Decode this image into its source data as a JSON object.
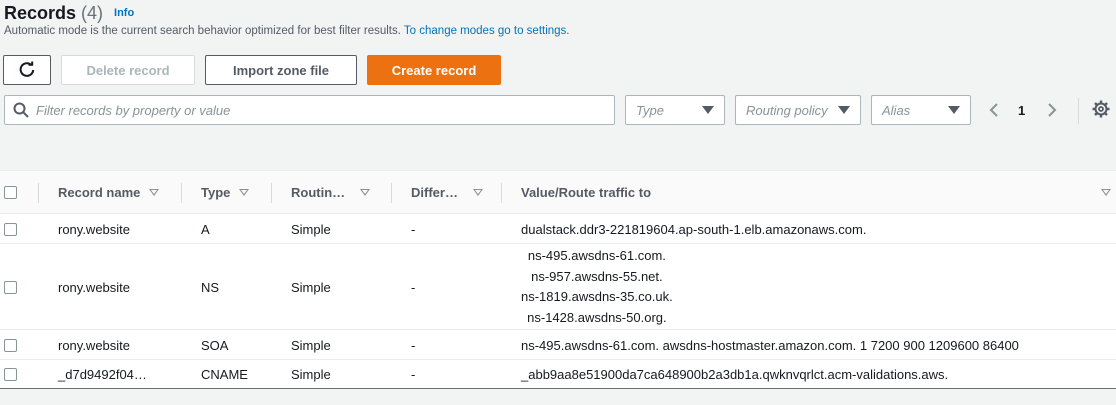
{
  "header": {
    "title": "Records",
    "count": "(4)",
    "info": "Info"
  },
  "description": {
    "text": "Automatic mode is the current search behavior optimized for best filter results. ",
    "link": "To change modes go to settings."
  },
  "toolbar": {
    "delete": "Delete record",
    "import": "Import zone file",
    "create": "Create record"
  },
  "filters": {
    "search_placeholder": "Filter records by property or value",
    "type": "Type",
    "routing": "Routing policy",
    "alias": "Alias"
  },
  "pagination": {
    "page": "1"
  },
  "columns": {
    "record_name": "Record name",
    "type": "Type",
    "routing": "Routin…",
    "differ": "Differ…",
    "value": "Value/Route traffic to"
  },
  "rows": [
    {
      "name": "rony.website",
      "type": "A",
      "routing": "Simple",
      "differ": "-",
      "values": [
        "dualstack.ddr3-221819604.ap-south-1.elb.amazonaws.com."
      ]
    },
    {
      "name": "rony.website",
      "type": "NS",
      "routing": "Simple",
      "differ": "-",
      "values": [
        "ns-495.awsdns-61.com.",
        "ns-957.awsdns-55.net.",
        "ns-1819.awsdns-35.co.uk.",
        "ns-1428.awsdns-50.org."
      ]
    },
    {
      "name": "rony.website",
      "type": "SOA",
      "routing": "Simple",
      "differ": "-",
      "values": [
        "ns-495.awsdns-61.com. awsdns-hostmaster.amazon.com. 1 7200 900 1209600 86400"
      ]
    },
    {
      "name": "_d7d9492f04…",
      "type": "CNAME",
      "routing": "Simple",
      "differ": "-",
      "values": [
        "_abb9aa8e51900da7ca648900b2a3db1a.qwknvqrlct.acm-validations.aws."
      ]
    }
  ],
  "colors": {
    "accent": "#ec7211",
    "link": "#0073bb"
  }
}
